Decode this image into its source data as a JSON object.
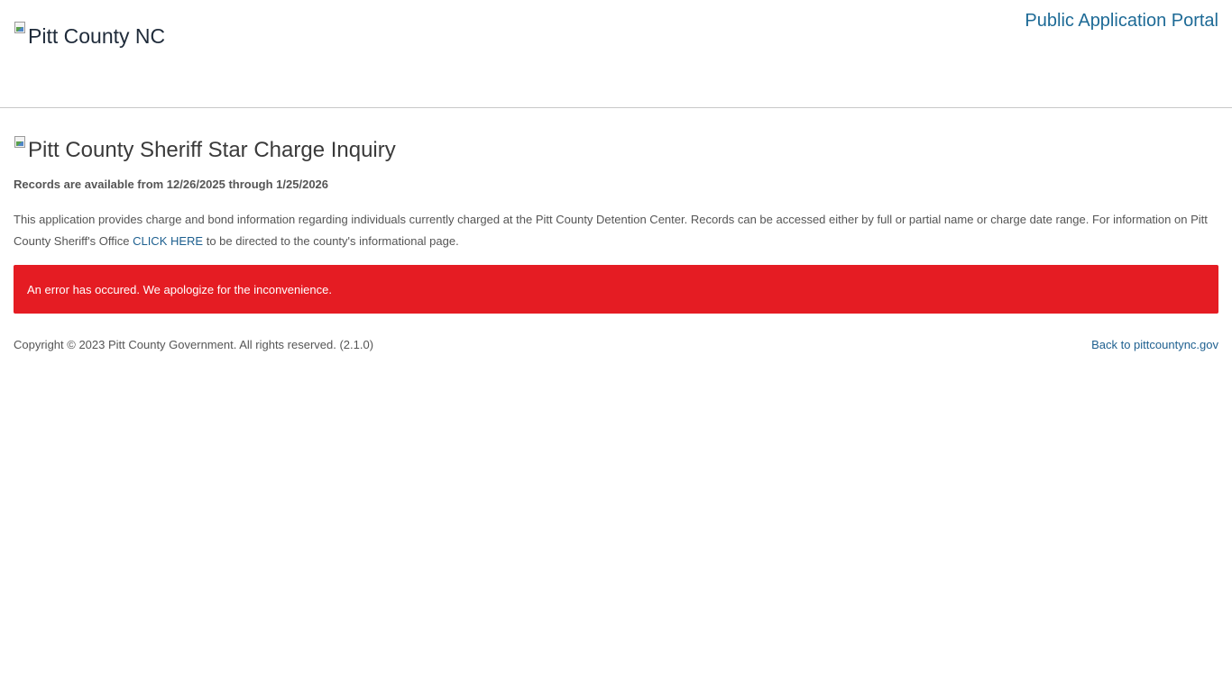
{
  "header": {
    "logo_alt": "Pitt County NC",
    "portal_title": "Public Application Portal"
  },
  "main": {
    "heading_alt": "Pitt County Sheriff Star Charge Inquiry",
    "availability": "Records are available from 12/26/2025 through 1/25/2026",
    "description_before": "This application provides charge and bond information regarding individuals currently charged at the Pitt County Detention Center. Records can be accessed either by full or partial name or charge date range. For information on Pitt County Sheriff's Office ",
    "description_link": "CLICK HERE",
    "description_after": " to be directed to the county's informational page.",
    "error_message": "An error has occured. We apologize for the inconvenience."
  },
  "footer": {
    "copyright": "Copyright © 2023 Pitt County Government. All rights reserved. (2.1.0)",
    "back_link": "Back to pittcountync.gov"
  },
  "colors": {
    "error_background": "#e51c23",
    "link": "#1d6a96"
  },
  "icons": {
    "logo": "broken-image-icon",
    "heading": "broken-image-icon"
  }
}
